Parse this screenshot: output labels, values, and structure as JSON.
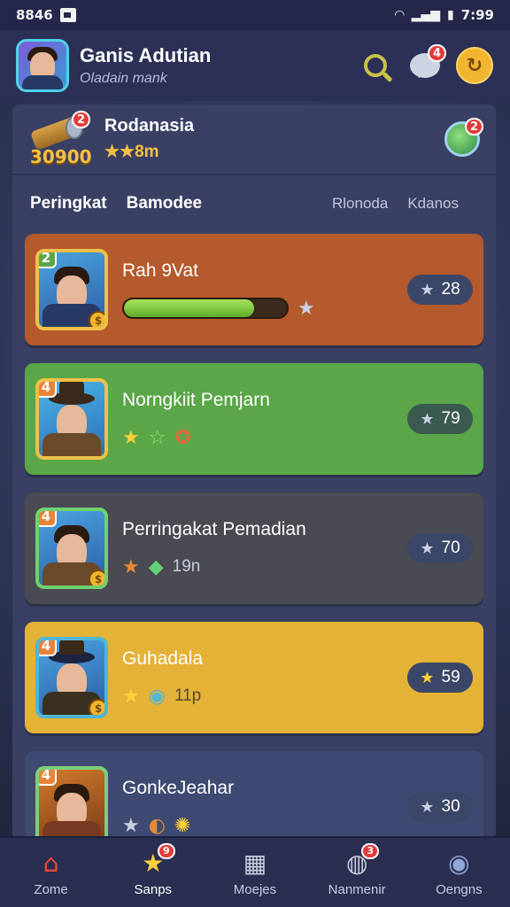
{
  "status_bar": {
    "time_left": "8846",
    "time_right": "7:99"
  },
  "header": {
    "title": "Ganis Adutian",
    "subtitle": "Oladain mank",
    "chat_badge": "4"
  },
  "reward": {
    "name": "Rodanasia",
    "coins": "30900",
    "stars_value": "8m",
    "badge": "2",
    "globe_badge": "2"
  },
  "tabs": {
    "active": [
      "Peringkat",
      "Bamodee"
    ],
    "inactive": [
      "Rlonoda",
      "Kdanos"
    ]
  },
  "players": [
    {
      "rank": "2",
      "name": "Rah 9Vat",
      "progress": 0.8,
      "score": "28",
      "color": "#b45a2c",
      "border": "#f0c04a",
      "gold": false
    },
    {
      "rank": "4",
      "name": "Norngkiit Pemjarn",
      "score": "79",
      "color": "#5aa648",
      "border": "#f0c04a",
      "gold": false
    },
    {
      "rank": "4",
      "name": "Perringakat Pemadian",
      "sub": "19n",
      "score": "70",
      "color": "#4a4a52",
      "border": "#6fd26f",
      "gold": false
    },
    {
      "rank": "4",
      "name": "Guhadala",
      "sub": "11p",
      "score": "59",
      "color": "#e3b236",
      "border": "#4fb6d6",
      "gold": true
    },
    {
      "rank": "4",
      "name": "GonkeJeahar",
      "score": "30",
      "color": "#3e4a72",
      "border": "#7ad07a",
      "gold": false
    }
  ],
  "nav": [
    {
      "label": "Zome",
      "icon": "home-icon"
    },
    {
      "label": "Sanps",
      "icon": "star-icon",
      "badge": "9"
    },
    {
      "label": "Moejes",
      "icon": "grid-icon"
    },
    {
      "label": "Nanmenir",
      "icon": "bell-icon",
      "badge": "3"
    },
    {
      "label": "Oengns",
      "icon": "settings-icon"
    }
  ]
}
